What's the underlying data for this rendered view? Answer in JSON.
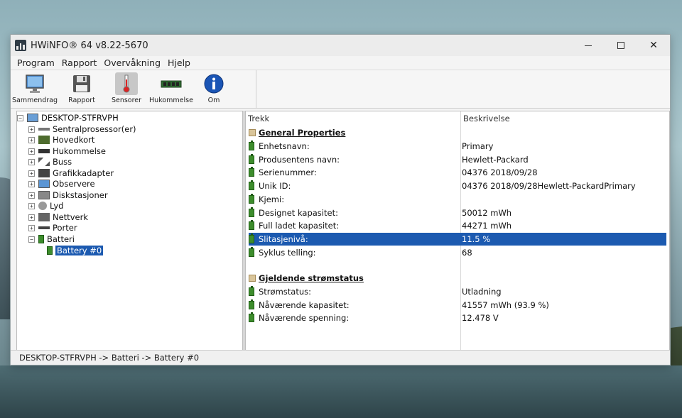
{
  "window": {
    "title": "HWiNFO® 64 v8.22-5670"
  },
  "menu": [
    "Program",
    "Rapport",
    "Overvåkning",
    "Hjelp"
  ],
  "toolbar": [
    {
      "label": "Sammendrag",
      "icon": "monitor-icon"
    },
    {
      "label": "Rapport",
      "icon": "floppy-disk-icon"
    },
    {
      "label": "Sensorer",
      "icon": "thermometer-icon"
    },
    {
      "label": "Hukommelse",
      "icon": "memory-module-icon"
    },
    {
      "label": "Om",
      "icon": "info-icon"
    }
  ],
  "tree": {
    "root": "DESKTOP-STFRVPH",
    "items": [
      {
        "label": "Sentralprosessor(er)",
        "expander": "+"
      },
      {
        "label": "Hovedkort",
        "expander": "+"
      },
      {
        "label": "Hukommelse",
        "expander": "+"
      },
      {
        "label": "Buss",
        "expander": "+"
      },
      {
        "label": "Grafikkadapter",
        "expander": "+"
      },
      {
        "label": "Observere",
        "expander": "+"
      },
      {
        "label": "Diskstasjoner",
        "expander": "+"
      },
      {
        "label": "Lyd",
        "expander": "+"
      },
      {
        "label": "Nettverk",
        "expander": "+"
      },
      {
        "label": "Porter",
        "expander": "+"
      },
      {
        "label": "Batteri",
        "expander": "−"
      }
    ],
    "selected_child": "Battery #0"
  },
  "details": {
    "col_feature": "Trekk",
    "col_description": "Beskrivelse",
    "section1": "General Properties",
    "rows1": [
      {
        "label": "Enhetsnavn:",
        "value": "Primary"
      },
      {
        "label": "Produsentens navn:",
        "value": "Hewlett-Packard"
      },
      {
        "label": "Serienummer:",
        "value": "04376 2018/09/28"
      },
      {
        "label": "Unik ID:",
        "value": "04376 2018/09/28Hewlett-PackardPrimary"
      },
      {
        "label": "Kjemi:",
        "value": ""
      },
      {
        "label": "Designet kapasitet:",
        "value": "50012 mWh"
      },
      {
        "label": "Full ladet kapasitet:",
        "value": "44271 mWh"
      },
      {
        "label": "Slitasjenivå:",
        "value": "11.5 %"
      },
      {
        "label": "Syklus telling:",
        "value": "68"
      }
    ],
    "section2": "Gjeldende strømstatus",
    "rows2": [
      {
        "label": "Strømstatus:",
        "value": "Utladning"
      },
      {
        "label": "Nåværende kapasitet:",
        "value": "41557 mWh (93.9 %)"
      },
      {
        "label": "Nåværende spenning:",
        "value": "12.478 V"
      }
    ]
  },
  "status": "DESKTOP-STFRVPH -> Batteri -> Battery #0",
  "colors": {
    "selection": "#1c5ab0",
    "battery": "#3d8d2c"
  }
}
